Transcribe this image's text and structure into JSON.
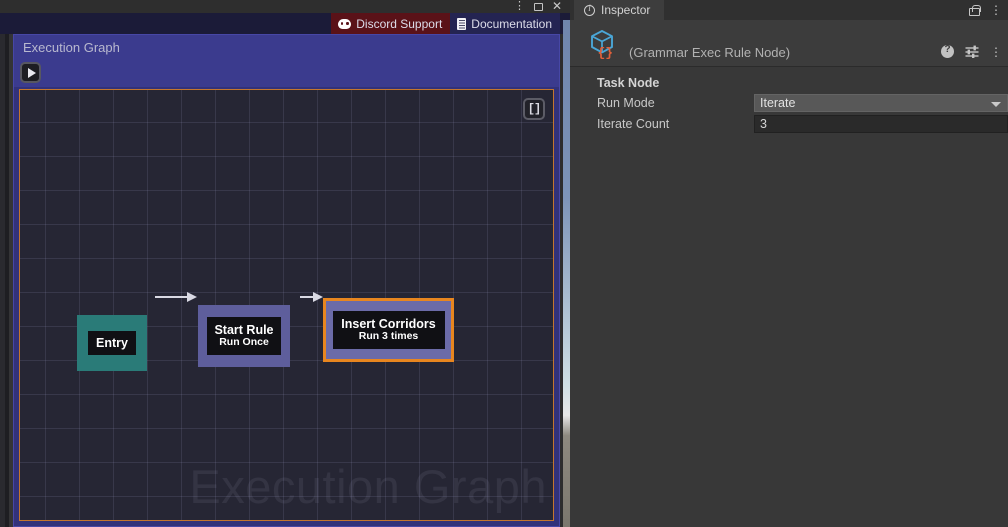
{
  "window": {
    "controls": [
      {
        "name": "more-menu",
        "glyph": "⋮"
      },
      {
        "name": "maximize",
        "glyph": ""
      },
      {
        "name": "close",
        "glyph": "✕"
      }
    ]
  },
  "links": {
    "discord": {
      "label": "Discord Support",
      "icon": "discord-icon",
      "color": "#5a1218"
    },
    "documentation": {
      "label": "Documentation",
      "icon": "document-icon",
      "color": "#242452"
    }
  },
  "editor": {
    "title": "Execution Graph",
    "play_button": "play-icon",
    "bracket_button": "[]",
    "watermark": "Execution Graph",
    "accent_border": "#c4762e",
    "panel_color": "#3b3b8e"
  },
  "graph": {
    "nodes": [
      {
        "id": "entry",
        "title": "Entry",
        "subtitle": "",
        "color": "#2a7b78",
        "selected": false
      },
      {
        "id": "start-rule",
        "title": "Start Rule",
        "subtitle": "Run Once",
        "color": "#5e5e9c",
        "selected": false
      },
      {
        "id": "insert-corridors",
        "title": "Insert Corridors",
        "subtitle": "Run 3 times",
        "color": "#6b6ba8",
        "selected": true,
        "selection_color": "#e8861f"
      }
    ],
    "edges": [
      {
        "from": "entry",
        "to": "start-rule"
      },
      {
        "from": "start-rule",
        "to": "insert-corridors"
      }
    ]
  },
  "inspector": {
    "tab_label": "Inspector",
    "tab_icon": "info-icon",
    "lock_icon": "lock-icon",
    "tab_menu_icon": "kebab-menu-icon",
    "object_name": "(Grammar Exec Rule Node)",
    "object_icon": "scriptable-object-cube-icon",
    "help_icon": "help-icon",
    "preset_icon": "preset-settings-icon",
    "menu_icon": "kebab-menu-icon",
    "section_header": "Task Node",
    "properties": [
      {
        "label": "Run Mode",
        "type": "dropdown",
        "value": "Iterate",
        "options": [
          "Iterate"
        ]
      },
      {
        "label": "Iterate Count",
        "type": "text",
        "value": "3"
      }
    ]
  }
}
